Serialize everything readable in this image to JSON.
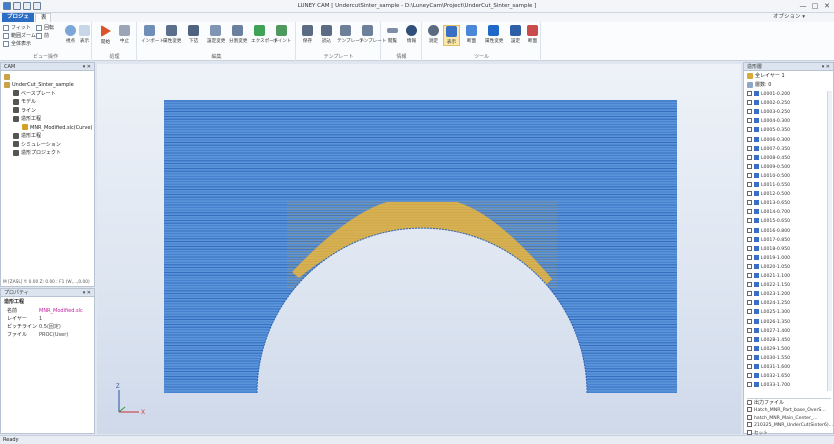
{
  "window": {
    "title": "LUNEY CAM  [ UndercutSinter_sample - D:\\LuneyCam\\Project\\UnderCut_Sinter_sample ]",
    "controls": [
      "—",
      "□",
      "✕"
    ]
  },
  "tabs": [
    {
      "label": "プロジェクト",
      "active": true
    },
    {
      "label": "表示",
      "active": false
    }
  ],
  "tab_right": "オプション ▾",
  "ribbon": {
    "view_group": {
      "label": "ビュー操作",
      "items": [
        "フィット",
        "範囲ズーム",
        "全体表示"
      ],
      "items2": [
        "回転",
        "前"
      ],
      "big": [
        "視点",
        "表示"
      ]
    },
    "process": {
      "label": "処理",
      "buttons": [
        "開始",
        "中止"
      ]
    },
    "edit": {
      "label": "編集",
      "buttons": [
        "インポート",
        "属性変更",
        "下詰",
        "設定変更",
        "分割変更",
        "エクスポート",
        "ポイント"
      ]
    },
    "template": {
      "label": "テンプレート",
      "buttons": [
        "保存",
        "読込",
        "テンプレート",
        "テンプレート"
      ]
    },
    "help": {
      "label": "情報",
      "buttons": [
        "閲覧",
        "情報"
      ]
    },
    "tools": {
      "label": "ツール",
      "buttons": [
        "測定",
        "表示",
        "断面",
        "属性変更",
        "設定",
        "断面"
      ]
    }
  },
  "cam_panel": {
    "title": "CAM",
    "tree": [
      {
        "label": "UnderCut_Sinter_sample",
        "indent": 0,
        "color": "#c9a24a"
      },
      {
        "label": "ベースプレート",
        "indent": 1,
        "color": "#555555"
      },
      {
        "label": "モデル",
        "indent": 1,
        "color": "#555555"
      },
      {
        "label": "ライン",
        "indent": 1,
        "color": "#555555"
      },
      {
        "label": "造形工程",
        "indent": 1,
        "color": "#555555"
      },
      {
        "label": "MNR_Modified.slc(Curve)",
        "indent": 2,
        "color": "#d4a020"
      },
      {
        "label": "造形工程",
        "indent": 1,
        "color": "#555555"
      },
      {
        "label": "シミュレーション",
        "indent": 1,
        "color": "#555555"
      },
      {
        "label": "造形プロジェクト",
        "indent": 1,
        "color": "#555555"
      }
    ],
    "footer": "M [ZASL] Y: 0.00 Z: 0.00 : F1 (W,...,0.00)"
  },
  "prop_panel": {
    "title": "プロパティ",
    "section": "造形工程",
    "rows": [
      {
        "key": "名前",
        "value": "MNR_Modified.slc"
      },
      {
        "key": "レイヤー",
        "value": "1"
      },
      {
        "key": "ピッチライン",
        "value": "0.5(固定)"
      },
      {
        "key": "ファイル",
        "value": "PROC(User)"
      }
    ]
  },
  "list_panel": {
    "title": "造形層",
    "filter_label": "全レイヤー 1",
    "search_label": "層数: 0",
    "layers": [
      "L0001-0.200",
      "L0002-0.250",
      "L0003-0.250",
      "L0004-0.300",
      "L0005-0.350",
      "L0006-0.300",
      "L0007-0.350",
      "L0008-0.450",
      "L0009-0.500",
      "L0010-0.500",
      "L0011-0.550",
      "L0012-0.500",
      "L0013-0.650",
      "L0014-0.700",
      "L0015-0.650",
      "L0016-0.800",
      "L0017-0.850",
      "L0018-0.950",
      "L0019-1.000",
      "L0020-1.050",
      "L0021-1.100",
      "L0022-1.150",
      "L0023-1.200",
      "L0024-1.250",
      "L0025-1.300",
      "L0026-1.350",
      "L0027-1.400",
      "L0028-1.450",
      "L0029-1.500",
      "L0030-1.550",
      "L0031-1.600",
      "L0032-1.650",
      "L0033-1.700"
    ],
    "section2": "出力ファイル",
    "files": [
      "Hatch_MNR_Part_base_OverS...",
      "hatch_MNR_Main_Center_...",
      "210325_MNR_UnderCut(Sinter6)...",
      "セット"
    ]
  },
  "axes": {
    "x": "X",
    "y": "Y",
    "z": "Z"
  },
  "status": "Ready"
}
